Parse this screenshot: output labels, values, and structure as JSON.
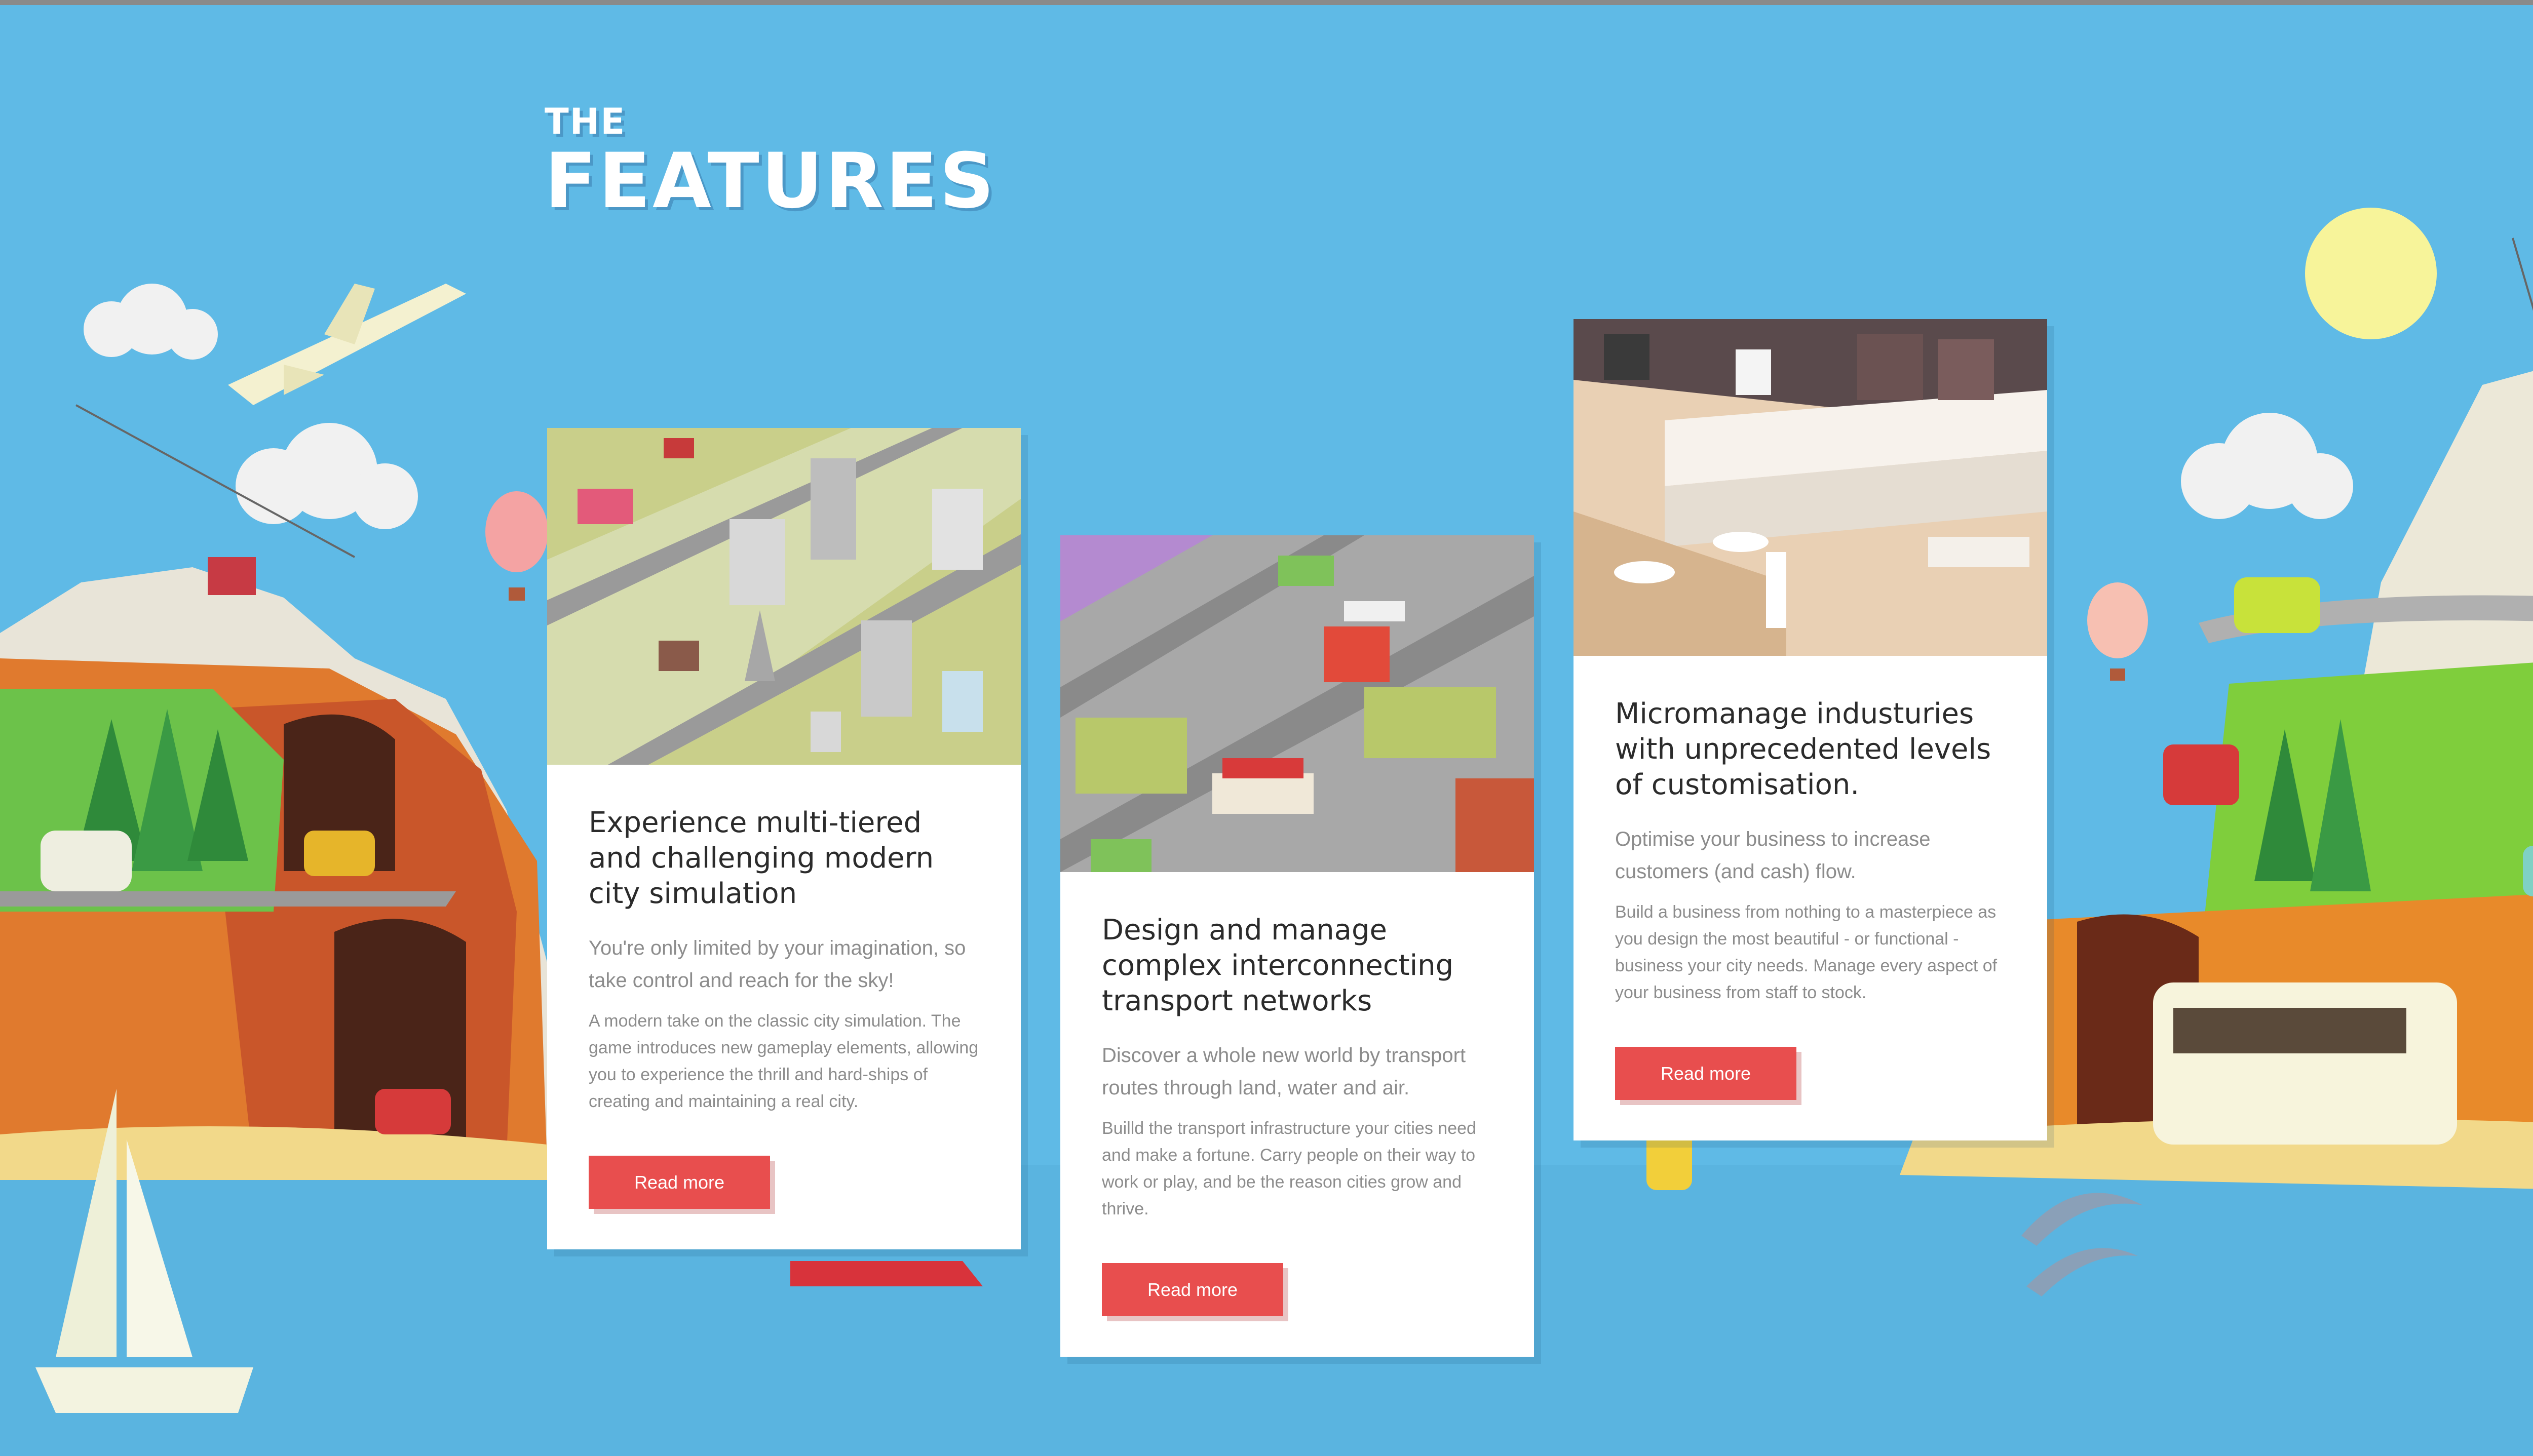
{
  "heading": {
    "small": "THE",
    "big": "FEATURES"
  },
  "cards": [
    {
      "title": "Experience multi-tiered and challenging modern city simulation",
      "lead": "You're only limited by your imagination, so take control and reach for the sky!",
      "text": "A modern take on the classic city simulation. The game introduces new gameplay elements, allowing you to experience the thrill and hard-ships of creating and maintaining a real city.",
      "button": "Read more",
      "image": "isometric-city-illustration"
    },
    {
      "title": "Design and manage complex interconnecting transport networks",
      "lead": "Discover a whole new world by transport routes through land, water and air.",
      "text": "Builld the transport infrastructure your cities need and make a fortune. Carry people on their way to work or play, and be the reason cities grow and thrive.",
      "button": "Read more",
      "image": "isometric-transport-illustration"
    },
    {
      "title": "Micromanage industuries with unprecedented levels of customisation.",
      "lead": "Optimise your business to increase customers (and cash) flow.",
      "text": "Build a business from nothing to a masterpiece as you design the most beautiful - or functional - business your city needs. Manage every aspect of your business from staff to stock.",
      "button": "Read more",
      "image": "isometric-cafe-illustration"
    }
  ],
  "colors": {
    "sky": "#5fbae6",
    "button": "#e84e4e",
    "title": "#2b2b2b",
    "body_text": "#8c8c8c",
    "card": "#ffffff"
  }
}
